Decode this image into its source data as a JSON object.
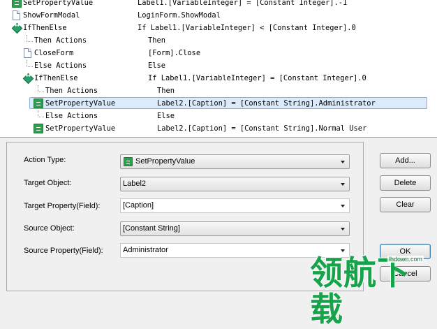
{
  "tree": {
    "rows": [
      {
        "name": "SetPropertyValue",
        "value": "Label1.[VariableInteger] = [Constant Integer].-1",
        "icon": "green-action-icon",
        "selected": false
      },
      {
        "name": "ShowFormModal",
        "value": "LoginForm.ShowModal",
        "icon": "document-icon",
        "selected": false
      },
      {
        "name": "IfThenElse",
        "value": "If Label1.[VariableInteger] < [Constant Integer].0",
        "icon": "diamond-condition-icon",
        "selected": false
      },
      {
        "name": "Then Actions",
        "value": "Then",
        "icon": "",
        "selected": false
      },
      {
        "name": "CloseForm",
        "value": "[Form].Close",
        "icon": "document-icon",
        "selected": false
      },
      {
        "name": "Else Actions",
        "value": "Else",
        "icon": "",
        "selected": false
      },
      {
        "name": "IfThenElse",
        "value": "If Label1.[VariableInteger] = [Constant Integer].0",
        "icon": "diamond-condition-icon",
        "selected": false
      },
      {
        "name": "Then Actions",
        "value": "Then",
        "icon": "",
        "selected": false
      },
      {
        "name": "SetPropertyValue",
        "value": "Label2.[Caption] = [Constant String].Administrator",
        "icon": "green-action-icon",
        "selected": true
      },
      {
        "name": "Else Actions",
        "value": "Else",
        "icon": "",
        "selected": false
      },
      {
        "name": "SetPropertyValue",
        "value": "Label2.[Caption] = [Constant String].Normal User",
        "icon": "green-action-icon",
        "selected": false
      }
    ]
  },
  "form": {
    "action_type": {
      "label": "Action Type:",
      "value": "SetPropertyValue",
      "icon": "green-action-icon"
    },
    "target_object": {
      "label": "Target Object:",
      "value": "Label2"
    },
    "target_property": {
      "label": "Target Property(Field):",
      "value": "[Caption]"
    },
    "source_object": {
      "label": "Source Object:",
      "value": "[Constant String]"
    },
    "source_property": {
      "label": "Source Property(Field):",
      "value": "Administrator"
    }
  },
  "buttons": {
    "add": "Add...",
    "delete": "Delete",
    "clear": "Clear",
    "ok": "OK",
    "cancel": "Cancel"
  },
  "watermark": {
    "brand": "领航下载",
    "domain": "lhdown.com"
  },
  "colors": {
    "selection_bg": "#dcebfc",
    "selection_border": "#84acdd",
    "action_icon_green": "#2e9f4e",
    "watermark_green": "#16a34a"
  }
}
